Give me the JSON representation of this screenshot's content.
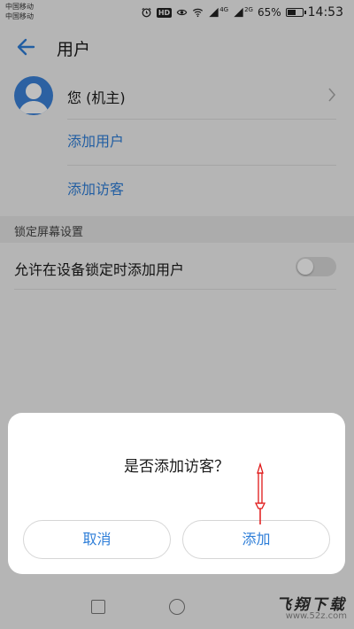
{
  "status_bar": {
    "carrier_1": "中国移动",
    "carrier_2": "中国移动",
    "hd_label": "HD",
    "network_1": "4G",
    "network_2": "2G",
    "battery_percent": "65%",
    "battery_level": 0.65,
    "time": "14:53"
  },
  "app_bar": {
    "title": "用户",
    "back_icon": "arrow-back"
  },
  "users": {
    "owner_label": "您 (机主)",
    "add_user_label": "添加用户",
    "add_guest_label": "添加访客"
  },
  "lock_screen": {
    "section_title": "锁定屏幕设置",
    "toggle_label": "允许在设备锁定时添加用户",
    "toggle_on": false
  },
  "dialog": {
    "title": "是否添加访客？",
    "cancel_label": "取消",
    "add_label": "添加"
  },
  "colors": {
    "accent": "#2e7ed8",
    "avatar": "#3b82d8",
    "annotation": "#e01818"
  },
  "watermark": {
    "main": "飞翔下载",
    "sub": "www.52z.com"
  }
}
